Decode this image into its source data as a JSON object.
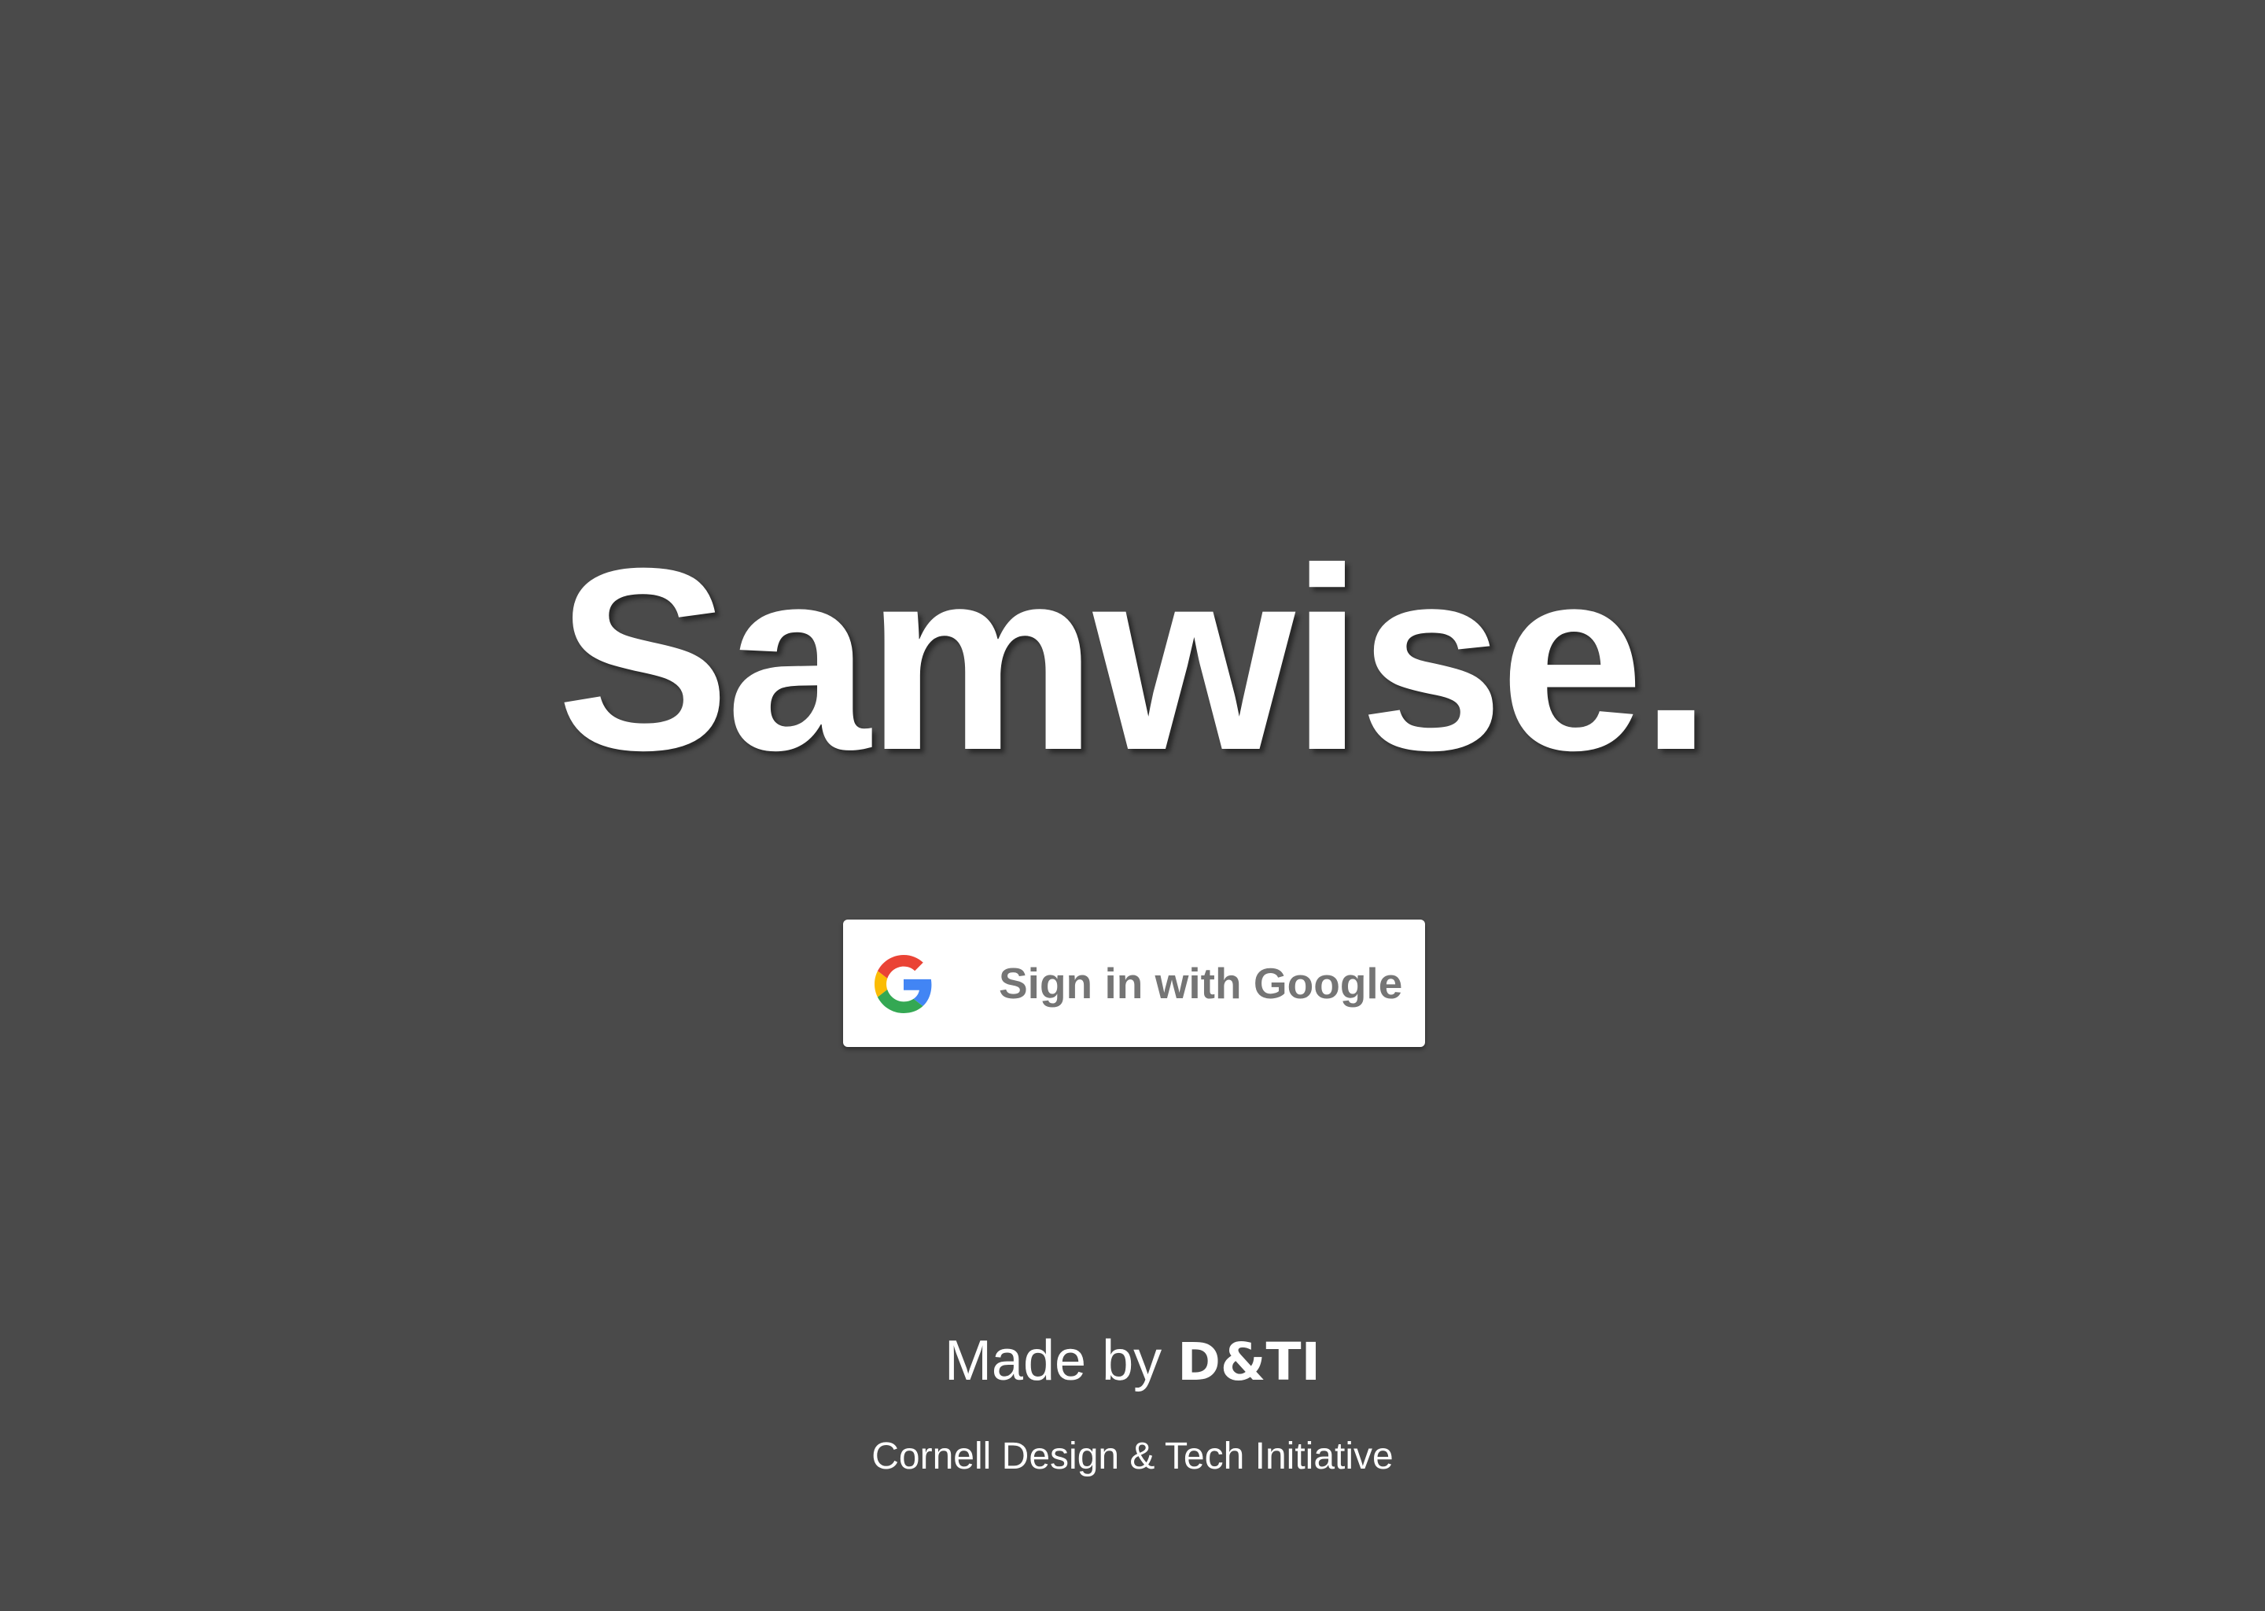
{
  "app": {
    "title": "Samwise."
  },
  "signin": {
    "label": "Sign in with Google",
    "icon": "google-g-icon"
  },
  "footer": {
    "made_by_prefix": "Made by ",
    "made_by_org": "D&TI",
    "org_full_name": "Cornell Design & Tech Initiative"
  },
  "colors": {
    "background": "#4a4a4a",
    "text": "#ffffff",
    "button_bg": "#ffffff",
    "button_text": "#757575",
    "google_blue": "#4285F4",
    "google_red": "#EA4335",
    "google_yellow": "#FBBC05",
    "google_green": "#34A853"
  }
}
